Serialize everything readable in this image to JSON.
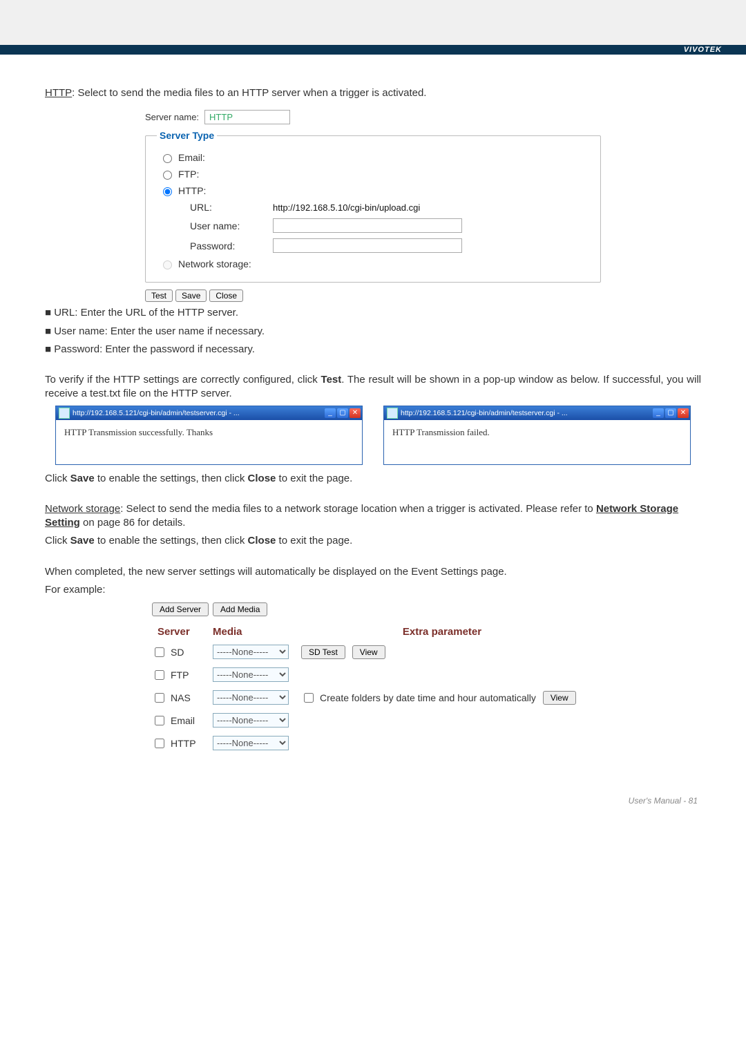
{
  "brand": "VIVOTEK",
  "intro": {
    "key": "HTTP",
    "text": ": Select to send the media files to an HTTP server when a trigger is activated."
  },
  "server_form": {
    "name_label": "Server name:",
    "name_value": "HTTP",
    "type_legend": "Server Type",
    "options": {
      "email": "Email:",
      "ftp": "FTP:",
      "http": "HTTP:",
      "ns": "Network storage:"
    },
    "fields": {
      "url_label": "URL:",
      "url_value": "http://192.168.5.10/cgi-bin/upload.cgi",
      "user_label": "User name:",
      "pass_label": "Password:"
    },
    "buttons": {
      "test": "Test",
      "save": "Save",
      "close": "Close"
    }
  },
  "bullets": {
    "b1": "■ URL: Enter the URL of the HTTP server.",
    "b2": "■ User name: Enter the user name if necessary.",
    "b3": "■ Password: Enter the password if necessary."
  },
  "verify": {
    "part1": "To verify if the HTTP settings are correctly configured, click ",
    "test": "Test",
    "part2": ". The result will be shown in a pop-up window as below. If successful, you will receive a test.txt file on the HTTP server."
  },
  "popups": {
    "url": "http://192.168.5.121/cgi-bin/admin/testserver.cgi - ...",
    "ok": "HTTP Transmission successfully. Thanks",
    "fail": "HTTP Transmission failed."
  },
  "save_close": {
    "pre": "Click ",
    "save": "Save",
    "mid": " to enable the settings, then click ",
    "close": "Close",
    "post": " to exit the page."
  },
  "ns": {
    "title": "Network storage",
    "rest1": ": Select to send the media files to a network storage location when a trigger is activated. Please refer to ",
    "link": "Network Storage Setting",
    "rest2": " on page 86 for details."
  },
  "completed": {
    "l1": "When completed, the new server settings will automatically be displayed on the Event Settings page.",
    "l2": "For example:"
  },
  "evt": {
    "add_server": "Add Server",
    "add_media": "Add Media",
    "hdr": {
      "server": "Server",
      "media": "Media",
      "extra": "Extra parameter"
    },
    "none": "-----None-----",
    "rows": [
      {
        "name": "SD"
      },
      {
        "name": "FTP"
      },
      {
        "name": "NAS"
      },
      {
        "name": "Email"
      },
      {
        "name": "HTTP"
      }
    ],
    "sd_test": "SD Test",
    "view": "View",
    "nas_auto": "Create folders by date time and hour automatically"
  },
  "footer": "User's Manual - 81"
}
